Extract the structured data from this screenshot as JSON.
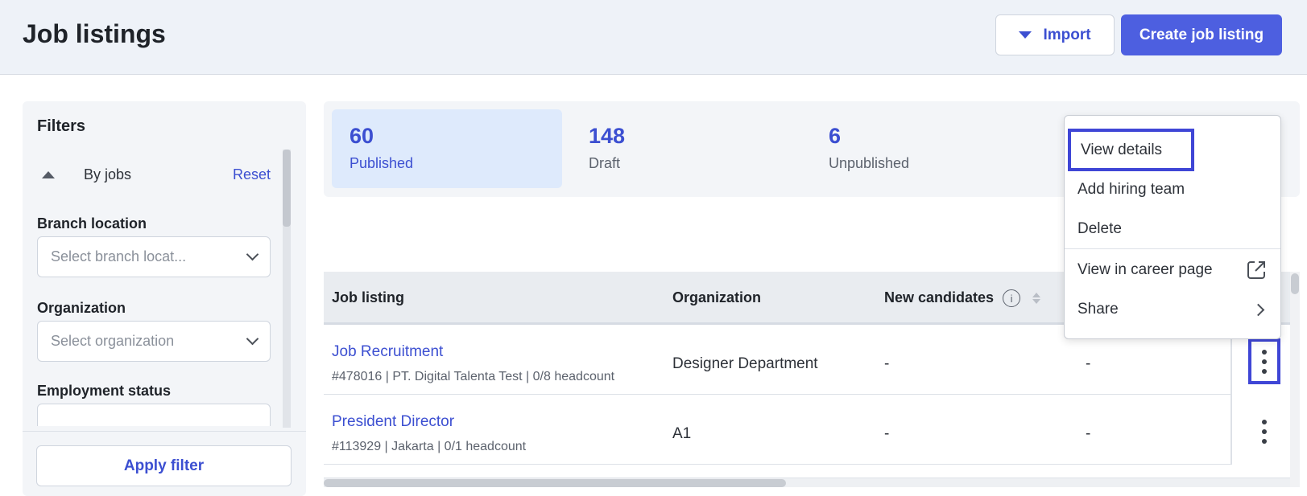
{
  "header": {
    "title": "Job listings",
    "import_label": "Import",
    "create_label": "Create job listing"
  },
  "filters": {
    "title": "Filters",
    "group_label": "By jobs",
    "reset_label": "Reset",
    "branch": {
      "label": "Branch location",
      "placeholder": "Select branch locat..."
    },
    "organization": {
      "label": "Organization",
      "placeholder": "Select organization"
    },
    "employment": {
      "label": "Employment status"
    },
    "apply_label": "Apply filter"
  },
  "stats": [
    {
      "count": "60",
      "label": "Published"
    },
    {
      "count": "148",
      "label": "Draft"
    },
    {
      "count": "6",
      "label": "Unpublished"
    }
  ],
  "table": {
    "columns": [
      "Job listing",
      "Organization",
      "New candidates"
    ],
    "rows": [
      {
        "title": "Job Recruitment",
        "meta": "#478016 | PT. Digital Talenta Test | 0/8 headcount",
        "organization": "Designer Department",
        "new_candidates": "-",
        "col4": "-"
      },
      {
        "title": "President Director",
        "meta": "#113929 | Jakarta | 0/1 headcount",
        "organization": "A1",
        "new_candidates": "-",
        "col4": "-"
      }
    ]
  },
  "menu": {
    "items": [
      "View details",
      "Add hiring team",
      "Delete",
      "View in career page",
      "Share"
    ]
  },
  "colors": {
    "accent": "#4d5fe0",
    "link": "#3c4fd1",
    "highlight_box": "#3f46d6"
  }
}
